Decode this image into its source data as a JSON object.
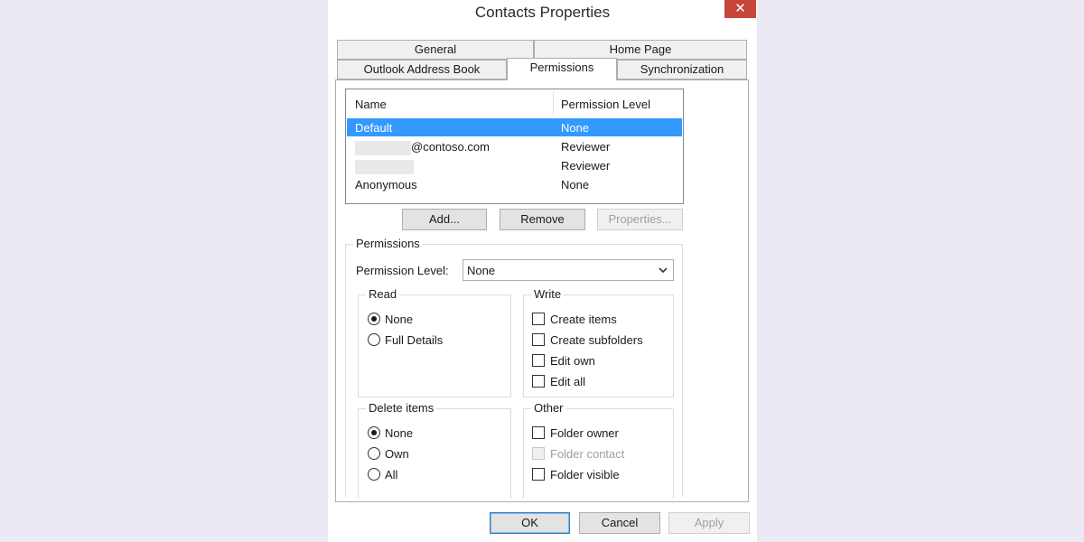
{
  "window": {
    "title": "Contacts Properties",
    "close_glyph": "✕"
  },
  "tabs": [
    {
      "label": "General"
    },
    {
      "label": "Home Page"
    },
    {
      "label": "Outlook Address Book"
    },
    {
      "label": "Permissions",
      "active": true
    },
    {
      "label": "Synchronization"
    }
  ],
  "perm_list": {
    "headers": {
      "name": "Name",
      "level": "Permission Level"
    },
    "rows": [
      {
        "name": "Default",
        "level": "None",
        "selected": true
      },
      {
        "name": "@contoso.com",
        "level": "Reviewer",
        "redacted_prefix": true
      },
      {
        "name": "",
        "level": "Reviewer",
        "redacted": true
      },
      {
        "name": "Anonymous",
        "level": "None"
      }
    ]
  },
  "list_buttons": {
    "add": "Add...",
    "remove": "Remove",
    "properties": "Properties..."
  },
  "permissions": {
    "group_title": "Permissions",
    "level_label": "Permission Level:",
    "level_value": "None",
    "read": {
      "title": "Read",
      "options": [
        {
          "label": "None",
          "checked": true
        },
        {
          "label": "Full Details",
          "checked": false
        }
      ]
    },
    "write": {
      "title": "Write",
      "options": [
        {
          "label": "Create items",
          "checked": false
        },
        {
          "label": "Create subfolders",
          "checked": false
        },
        {
          "label": "Edit own",
          "checked": false
        },
        {
          "label": "Edit all",
          "checked": false
        }
      ]
    },
    "delete": {
      "title": "Delete items",
      "options": [
        {
          "label": "None",
          "checked": true
        },
        {
          "label": "Own",
          "checked": false
        },
        {
          "label": "All",
          "checked": false
        }
      ]
    },
    "other": {
      "title": "Other",
      "options": [
        {
          "label": "Folder owner",
          "checked": false,
          "disabled": false
        },
        {
          "label": "Folder contact",
          "checked": false,
          "disabled": true
        },
        {
          "label": "Folder visible",
          "checked": false,
          "disabled": false
        }
      ]
    }
  },
  "footer": {
    "ok": "OK",
    "cancel": "Cancel",
    "apply": "Apply"
  },
  "colors": {
    "selection": "#3399ff",
    "close_button": "#c7453a",
    "background": "#ece9f5"
  }
}
